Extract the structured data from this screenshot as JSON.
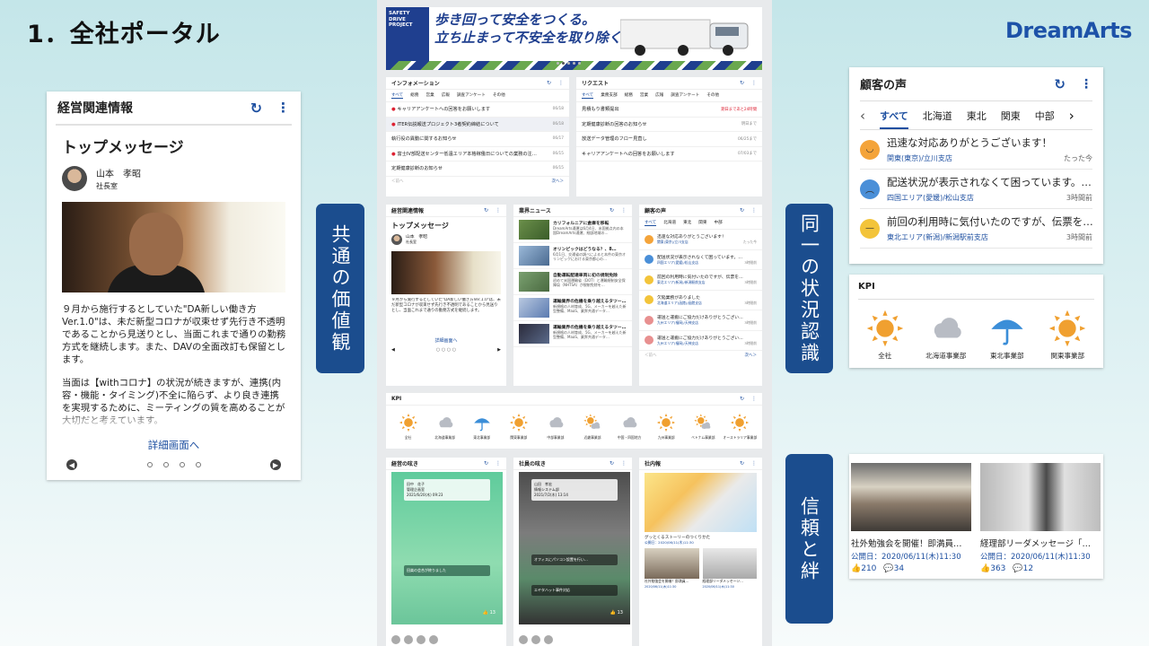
{
  "slide": {
    "title": "1．全社ポータル",
    "brand": "DreamArts"
  },
  "labels": {
    "values": "共通の価値観",
    "awareness": "同一の状況認識",
    "trust": "信頼と絆"
  },
  "left_card": {
    "title": "経営関連情報",
    "heading": "トップメッセージ",
    "person_name": "山本　孝昭",
    "person_role": "社長室",
    "paragraph1": "９月から施行するとしていた\"DA新しい働き方Ver.1.0\"は、未だ新型コロナが収束せず先行き不透明であることから見送りとし、当面これまで通りの勤務方式を継続します。また、DAVの全面改訂も保留とします。",
    "paragraph2": "当面は【withコロナ】の状況が続きますが、連携(内容・機能・タイミング)不全に陥らず、より良き連携を実現するために、ミーティングの質を高めることが大切だと考えています。",
    "detail_link": "詳細画面へ"
  },
  "portal": {
    "banner": {
      "side": "SAFETY DRIVE PROJECT",
      "line1": "歩き回って安全をつくる。",
      "line2": "立ち止まって不安全を取り除く。"
    },
    "info": {
      "title": "インフォメーション",
      "tabs": [
        "すべて",
        "総務",
        "営業",
        "広報",
        "調査アンケート",
        "その他"
      ],
      "rows": [
        {
          "text": "キャリアアンケートへの回答をお願いします",
          "date": "06/18",
          "new": true
        },
        {
          "text": "ITER伝説報送プロジェクト3者契約締結について",
          "date": "06/18",
          "new": true
        },
        {
          "text": "執行役の異動に関するお知らせ",
          "date": "06/17",
          "new": false
        },
        {
          "text": "富士IV部配送センター低温エリア本格稼働日についての業務の注…",
          "date": "06/15",
          "new": true
        },
        {
          "text": "定期健康診断のお知らせ",
          "date": "06/15",
          "new": false
        }
      ],
      "prev": "＜前へ",
      "next": "次へ＞"
    },
    "request": {
      "title": "リクエスト",
      "tabs": [
        "すべて",
        "業務支部",
        "総務",
        "営業",
        "広報",
        "調査アンケート",
        "その他"
      ],
      "rows": [
        {
          "text": "見積もり書類提出",
          "date": "期日まであと24時間"
        },
        {
          "text": "定期健康診断の回答のお知らせ",
          "date": "明日まで"
        },
        {
          "text": "放送データ管理のフロー見直し",
          "date": "06/25まで"
        },
        {
          "text": "キャリアアンケートへの回答をお願いします",
          "date": "07/03まで"
        }
      ]
    },
    "mgmt": {
      "title": "経営関連情報",
      "heading": "トップメッセージ",
      "name": "山本　孝昭",
      "role": "社長室",
      "text": "９月から施行するとしていた\"DA新しい働き方Ver.1.0\"は、未だ新型コロナが収束せず先行き不透明であることから見送りとし、当面これまで通りの勤務方式を継続します。",
      "link": "詳細画面へ"
    },
    "industry": {
      "title": "業界ニュース",
      "rows": [
        {
          "title": "カリフォルニアに倉庫を移転",
          "desc": "DreamArts通運は6月4日、米国拠点内の本国DreamArts通運、細部地域の…"
        },
        {
          "title": "オリンピックはどうなる？、8…",
          "desc": "6月1日、交通省の調べによると本件の東京オリンピックにおける東京都心の…"
        },
        {
          "title": "自動運転配達車両に初の規制免除",
          "desc": "初めて米国運輸省（DOT）と運輸規制安全保障局（NHTSA）が規制免除を…"
        },
        {
          "title": "運輸業界の危機を乗り越えるタツー…",
          "desc": "新規格の人材育成、5G、メーカーを越えた新型整備、MaaS、業界共通データ…"
        },
        {
          "title": "運輸業界の危機を乗り越えるタツー…",
          "desc": "新規格の人材育成、5G、メーカーを越えた新型整備、MaaS、業界共通データ…"
        }
      ]
    },
    "voice": {
      "title": "顧客の声",
      "tabs": [
        "すべて",
        "北海道",
        "東北",
        "関東",
        "中部"
      ],
      "rows": [
        {
          "text": "迅速な対応ありがとうございます！",
          "area": "関東(東京)/立川支店",
          "time": "たった今"
        },
        {
          "text": "配送状況が表示されなくて困っています。…",
          "area": "四国エリア(愛媛)/松山支店",
          "time": "3時間前"
        },
        {
          "text": "前回の利用時に気付いたのですが、伝票を…",
          "area": "東北エリア(新潟)/新潟駅前支店",
          "time": "3時間前"
        },
        {
          "text": "欠陥業務がありました",
          "area": "北海道エリア(函館)/函館支店",
          "time": "3時間前"
        },
        {
          "text": "運送と運搬にご協力だけありがとうござい…",
          "area": "九州エリア(福岡)/天神支店",
          "time": "3時間前"
        },
        {
          "text": "運送と運搬にご協力だけありがとうござい…",
          "area": "九州エリア(福岡)/天神支店",
          "time": "3時間前"
        }
      ],
      "prev": "＜前へ",
      "next": "次へ＞"
    },
    "kpi": {
      "title": "KPI",
      "items": [
        {
          "label": "全社",
          "icon": "sun-icon"
        },
        {
          "label": "北海道事業部",
          "icon": "cloud-icon"
        },
        {
          "label": "東北事業部",
          "icon": "umbrella-icon"
        },
        {
          "label": "関東事業部",
          "icon": "sun-icon"
        },
        {
          "label": "中部事業部",
          "icon": "cloud-icon"
        },
        {
          "label": "近畿事業部",
          "icon": "sun-cloud-icon"
        },
        {
          "label": "中国・四国地方",
          "icon": "cloud-icon"
        },
        {
          "label": "九州事業部",
          "icon": "sun-icon"
        },
        {
          "label": "ベトナム事業部",
          "icon": "sun-cloud-icon"
        },
        {
          "label": "オーストラリア事業部",
          "icon": "sun-icon"
        }
      ]
    },
    "mgmt_voice": {
      "title": "経営の呟き",
      "name": "田中　花子",
      "role": "管理企画室",
      "date": "2021/6/20(木) 09:23",
      "bubble": "田楽の会合が終りました",
      "count": "13"
    },
    "staff_voice": {
      "title": "社員の呟き",
      "name": "山田　孝宏",
      "role": "情報システム部",
      "date": "2021/7/2(木) 13:14",
      "bubble": "オフィスにパソコン設置を行い…",
      "tag": "エヤタハット事件対応",
      "count": "13"
    },
    "newsletter": {
      "title": "社内報",
      "main": "グッとくるストーリーのつくりかた",
      "main_date": "公開日：2020/06/11(木)11:30",
      "items": [
        {
          "title": "社外勉強会を開催！即満員…",
          "date": "2020/06/11(木)11:30"
        },
        {
          "title": "経理部リーダメッセージ…",
          "date": "2020/06/11(木)11:30"
        }
      ]
    }
  },
  "voice_card": {
    "title": "顧客の声",
    "tabs": [
      "すべて",
      "北海道",
      "東北",
      "関東",
      "中部"
    ],
    "rows": [
      {
        "text": "迅速な対応ありがとうございます！",
        "area": "関東(東京)/立川支店",
        "time": "たった今",
        "mood": "happy",
        "color": "#f4a43a"
      },
      {
        "text": "配送状況が表示されなくて困っています。…",
        "area": "四国エリア(愛媛)/松山支店",
        "time": "3時間前",
        "mood": "sad",
        "color": "#4a8fd8"
      },
      {
        "text": "前回の利用時に気付いたのですが、伝票を…",
        "area": "東北エリア(新潟)/新潟駅前支店",
        "time": "3時間前",
        "mood": "neutral",
        "color": "#f3c43a"
      }
    ]
  },
  "kpi_card": {
    "title": "KPI",
    "items": [
      {
        "label": "全社",
        "icon": "sun-icon"
      },
      {
        "label": "北海道事業部",
        "icon": "cloud-icon"
      },
      {
        "label": "東北事業部",
        "icon": "umbrella-icon"
      },
      {
        "label": "関東事業部",
        "icon": "sun-icon"
      }
    ]
  },
  "news_card": {
    "items": [
      {
        "title": "社外勉強会を開催！即満員…",
        "date": "公開日：2020/06/11(木)11:30",
        "likes": "210",
        "comments": "34"
      },
      {
        "title": "経理部リーダメッセージ「…",
        "date": "公開日：2020/06/11(木)11:30",
        "likes": "363",
        "comments": "12"
      }
    ]
  },
  "colors": {
    "accent": "#1d4fa0",
    "label_bg": "#1b4d8e",
    "sun": "#f0a030",
    "cloud": "#b8bcc4",
    "umbrella": "#3b8ed8"
  }
}
